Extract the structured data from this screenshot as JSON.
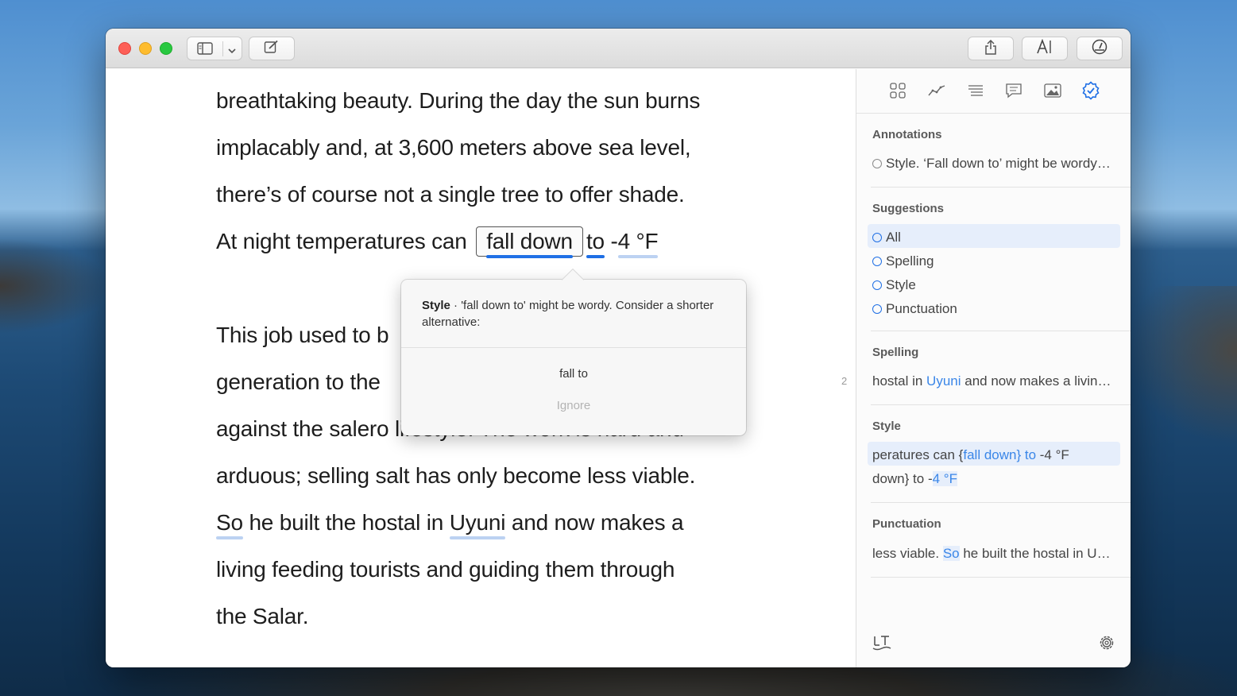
{
  "editor": {
    "line1": "breathtaking beauty. During the day the sun burns",
    "line2": "implacably and, at 3,600 meters above sea level,",
    "line3": "there’s of course not a single tree to offer shade.",
    "line4_pre": "At night temperatures can",
    "line4_flag": "fall down",
    "line4_to": "to",
    "line4_space": " -",
    "line4_tail": "4 °F",
    "line5": "This job used to b",
    "line6": "generation to the",
    "line7": "against the salero lifestyle. The work is hard and",
    "line8": "arduous; selling salt has only become less viable.",
    "line9_so": "So",
    "line9_mid": " he built the hostal in ",
    "line9_uyuni": "Uyuni",
    "line9_end": " and now makes a",
    "line10": "living feeding tourists and guiding them through",
    "line11": "the Salar.",
    "paragraph_number": "2"
  },
  "popover": {
    "category": "Style",
    "message": " · 'fall down to' might be wordy. Consider a shorter alternative:",
    "suggestion": "fall to",
    "ignore": "Ignore"
  },
  "sidebar": {
    "annotations": {
      "title": "Annotations",
      "item": "Style. ‘Fall down to’ might be wordy…"
    },
    "suggestions": {
      "title": "Suggestions",
      "items": [
        "All",
        "Spelling",
        "Style",
        "Punctuation"
      ]
    },
    "spelling": {
      "title": "Spelling",
      "pre": "hostal in ",
      "hl": "Uyuni",
      "post": " and now makes a livin…"
    },
    "style": {
      "title": "Style",
      "row1_pre": "peratures can {",
      "row1_hl": "fall down} to",
      "row1_post": " -4 °F",
      "row2_pre": "down} to -",
      "row2_hl": "4 °F"
    },
    "punctuation": {
      "title": "Punctuation",
      "pre": "less viable. ",
      "hl": "So",
      "post": " he built the hostal in U…"
    }
  },
  "icons": {
    "titlebar": [
      "sidebar-toggle-icon",
      "chevron-down-icon",
      "compose-icon",
      "share-icon",
      "font-icon",
      "goal-gauge-icon"
    ],
    "tabs": [
      "grid-icon",
      "chart-icon",
      "list-icon",
      "comment-icon",
      "image-icon",
      "checkmark-badge-icon"
    ],
    "bottom": [
      "language-tool-icon",
      "gear-icon"
    ]
  },
  "colors": {
    "accent": "#1f6fe5",
    "highlight": "#3a86e8",
    "selection": "#e6eefb"
  }
}
